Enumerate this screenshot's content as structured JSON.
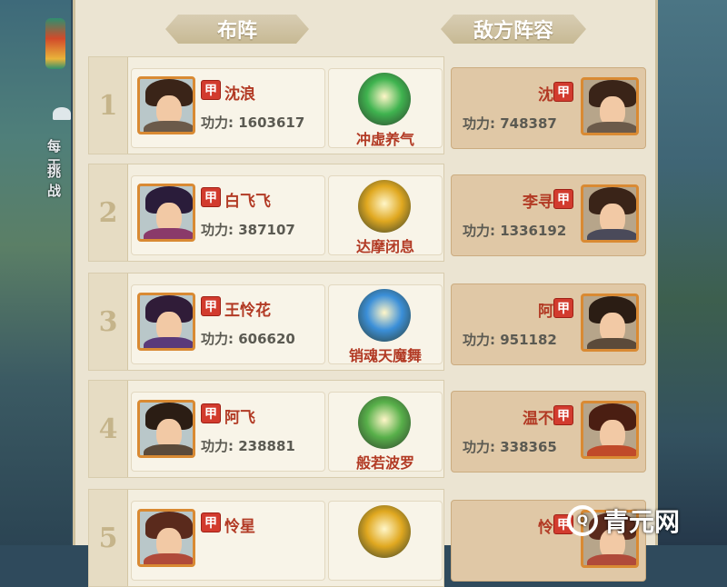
{
  "header": {
    "formation_label": "布阵",
    "enemy_label": "敌方阵容"
  },
  "badge_text": "甲",
  "side_texts": [
    "每天",
    "挑战"
  ],
  "power_prefix": "功力: ",
  "rows": [
    {
      "index": "1",
      "hero": {
        "name": "沈浪",
        "power": "1603617"
      },
      "skill": {
        "name": "冲虚养气",
        "icon": "green-buddha-icon",
        "color": "#3fb34f"
      },
      "enemy": {
        "name": "沈浪",
        "power": "748387"
      }
    },
    {
      "index": "2",
      "hero": {
        "name": "白飞飞",
        "power": "387107"
      },
      "skill": {
        "name": "达摩闭息",
        "icon": "gold-buddha-icon",
        "color": "#e0a820"
      },
      "enemy": {
        "name": "李寻欢",
        "power": "1336192"
      }
    },
    {
      "index": "3",
      "hero": {
        "name": "王怜花",
        "power": "606620"
      },
      "skill": {
        "name": "销魂天魔舞",
        "icon": "blue-dancer-icon",
        "color": "#3b8fd8"
      },
      "enemy": {
        "name": "阿飞",
        "power": "951182"
      }
    },
    {
      "index": "4",
      "hero": {
        "name": "阿飞",
        "power": "238881"
      },
      "skill": {
        "name": "般若波罗",
        "icon": "green-wheel-icon",
        "color": "#58b04a"
      },
      "enemy": {
        "name": "温不胜",
        "power": "338365"
      }
    },
    {
      "index": "5",
      "hero": {
        "name": "怜星",
        "power": ""
      },
      "skill": {
        "name": "",
        "icon": "gold-lotus-icon",
        "color": "#e0a820"
      },
      "enemy": {
        "name": "怜星",
        "power": ""
      }
    }
  ],
  "watermark": {
    "text": "青元网",
    "logo": "q-logo-icon"
  },
  "colors": {
    "badge_red": "#d23b2e",
    "name_red": "#b23a24",
    "panel": "#ebe4d2",
    "enemy_card": "#e0c8a6"
  }
}
